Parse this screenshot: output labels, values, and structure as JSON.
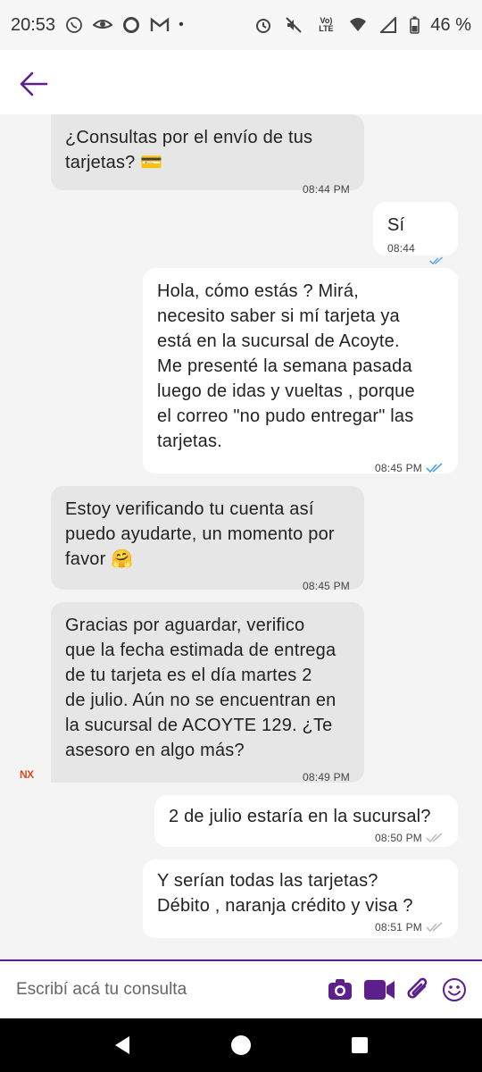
{
  "status_bar": {
    "time": "20:53",
    "battery": "46 %",
    "network_label": "Vo) LTE",
    "dot": "•"
  },
  "header": {
    "back_icon": "arrow-left-icon",
    "accent_color": "#5c1f8c"
  },
  "messages": [
    {
      "direction": "in",
      "text": "¿Consultas por el envío de tus\ntarjetas? 💳",
      "time": "08:44 PM"
    },
    {
      "direction": "out",
      "text": "Sí",
      "time": "08:44 PM",
      "read": true
    },
    {
      "direction": "out",
      "text": "Hola, cómo estás ? Mirá,\nnecesito saber si mí tarjeta ya\nestá en la sucursal de Acoyte.\nMe presenté la semana pasada\nluego de idas y vueltas , porque\nel correo \"no pudo entregar\" las\ntarjetas.",
      "time": "08:45 PM",
      "read": true
    },
    {
      "direction": "in",
      "text": "Estoy verificando tu cuenta así\npuedo ayudarte, un momento por\nfavor 🤗",
      "time": "08:45 PM"
    },
    {
      "direction": "in",
      "text": "Gracias por aguardar, verifico\nque la fecha estimada de entrega\nde tu tarjeta es el día martes 2\nde julio. Aún no se encuentran en\nla sucursal de ACOYTE 129. ¿Te\nasesoro en algo más?",
      "time": "08:49 PM"
    },
    {
      "direction": "out",
      "text": "2 de julio estaría en la sucursal?",
      "time": "08:50 PM",
      "read": false
    },
    {
      "direction": "out",
      "text": "Y serían todas las tarjetas?\nDébito , naranja crédito y visa ?",
      "time": "08:51 PM",
      "read": false
    }
  ],
  "agent_logo": "NX",
  "composer": {
    "placeholder": "Escribí acá tu consulta",
    "icons": [
      "camera-icon",
      "video-icon",
      "attach-icon",
      "emoji-icon"
    ]
  },
  "nav": {
    "icons": [
      "back-triangle-icon",
      "home-circle-icon",
      "recents-square-icon"
    ]
  },
  "colors": {
    "accent": "#5c1f8c",
    "incoming_bubble": "#e6e6e6",
    "outgoing_bubble": "#ffffff",
    "read_check": "#4aa3e0",
    "unread_check": "#bdbdbd"
  }
}
